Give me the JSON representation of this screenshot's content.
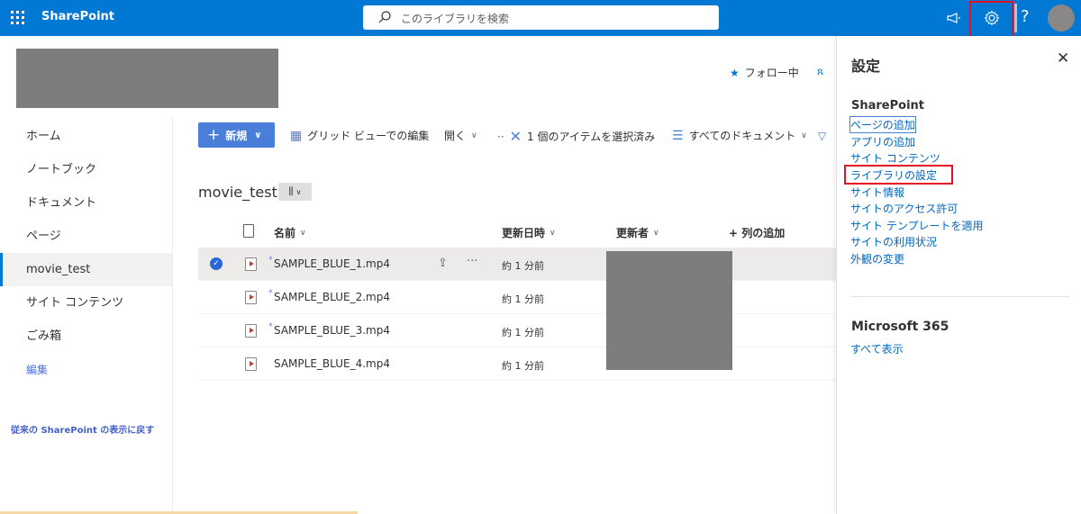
{
  "app": {
    "brand": "SharePoint",
    "search_placeholder": "このライブラリを検索",
    "help_label": "?"
  },
  "header": {
    "follow_label": "フォロー中"
  },
  "nav": {
    "items": [
      {
        "label": "ホーム"
      },
      {
        "label": "ノートブック"
      },
      {
        "label": "ドキュメント"
      },
      {
        "label": "ページ"
      },
      {
        "label": "movie_test"
      },
      {
        "label": "サイト コンテンツ"
      },
      {
        "label": "ごみ箱"
      }
    ],
    "edit_label": "編集",
    "classic_label": "従来の SharePoint の表示に戻す"
  },
  "commandbar": {
    "new_label": "新規",
    "grid_edit_label": "グリッド ビューでの編集",
    "open_label": "開く",
    "selected_label": "1 個のアイテムを選択済み",
    "view_label": "すべてのドキュメント"
  },
  "library": {
    "title": "movie_test",
    "columns": {
      "name": "名前",
      "modified": "更新日時",
      "modified_by": "更新者",
      "add_column": "+ 列の追加"
    },
    "files": [
      {
        "name": "SAMPLE_BLUE_1.mp4",
        "modified": "約 1 分前"
      },
      {
        "name": "SAMPLE_BLUE_2.mp4",
        "modified": "約 1 分前"
      },
      {
        "name": "SAMPLE_BLUE_3.mp4",
        "modified": "約 1 分前"
      },
      {
        "name": "SAMPLE_BLUE_4.mp4",
        "modified": "約 1 分前"
      }
    ]
  },
  "settings_panel": {
    "title": "設定",
    "sharepoint_heading": "SharePoint",
    "links": [
      {
        "label": "ページの追加"
      },
      {
        "label": "アプリの追加"
      },
      {
        "label": "サイト コンテンツ"
      },
      {
        "label": "ライブラリの設定"
      },
      {
        "label": "サイト情報"
      },
      {
        "label": "サイトのアクセス許可"
      },
      {
        "label": "サイト テンプレートを適用"
      },
      {
        "label": "サイトの利用状況"
      },
      {
        "label": "外観の変更"
      }
    ],
    "m365_heading": "Microsoft 365",
    "show_all_label": "すべて表示"
  },
  "colors": {
    "suitebar": "#0078d4",
    "accent": "#4a7fd9",
    "link": "#0067c0",
    "highlight": "#e81123"
  }
}
